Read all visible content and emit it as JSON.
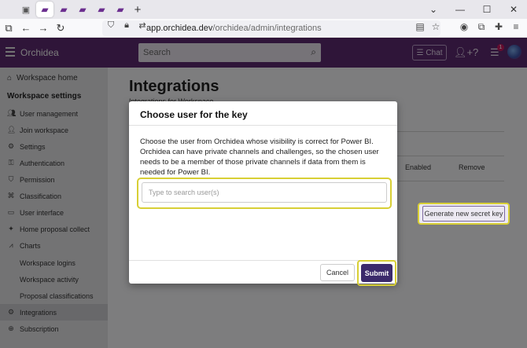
{
  "browser": {
    "url_domain": "app.orchidea.dev",
    "url_path": "/orchidea/admin/integrations",
    "new_tab": "+"
  },
  "header": {
    "brand": "Orchidea",
    "search_placeholder": "Search",
    "chat_label": "Chat",
    "notification_count": "1"
  },
  "sidebar": {
    "home": "Workspace home",
    "section_title": "Workspace settings",
    "items": [
      {
        "label": "User management",
        "icon": "users-icon"
      },
      {
        "label": "Join workspace",
        "icon": "join-icon"
      },
      {
        "label": "Settings",
        "icon": "gear-icon"
      },
      {
        "label": "Authentication",
        "icon": "auth-icon"
      },
      {
        "label": "Permission",
        "icon": "shield-icon"
      },
      {
        "label": "Classification",
        "icon": "tag-icon"
      },
      {
        "label": "User interface",
        "icon": "interface-icon"
      },
      {
        "label": "Home proposal collect",
        "icon": "bulb-icon"
      },
      {
        "label": "Charts",
        "icon": "chart-icon"
      }
    ],
    "sub_items": [
      "Workspace logins",
      "Workspace activity",
      "Proposal classifications"
    ],
    "bottom_items": [
      {
        "label": "Integrations",
        "icon": "integrations-icon"
      },
      {
        "label": "Subscription",
        "icon": "subscription-icon"
      }
    ]
  },
  "main": {
    "title": "Integrations",
    "subtitle": "Integrations for Workspace",
    "col_enabled": "Enabled",
    "col_remove": "Remove",
    "generate_key_label": "Generate new secret key"
  },
  "modal": {
    "title": "Choose user for the key",
    "description": "Choose the user from Orchidea whose visibility is correct for Power BI. Orchidea can have private channels and challenges, so the chosen user needs to be a member of those private channels if data from them is needed for Power BI.",
    "search_placeholder": "Type to search user(s)",
    "cancel_label": "Cancel",
    "submit_label": "Submit"
  }
}
